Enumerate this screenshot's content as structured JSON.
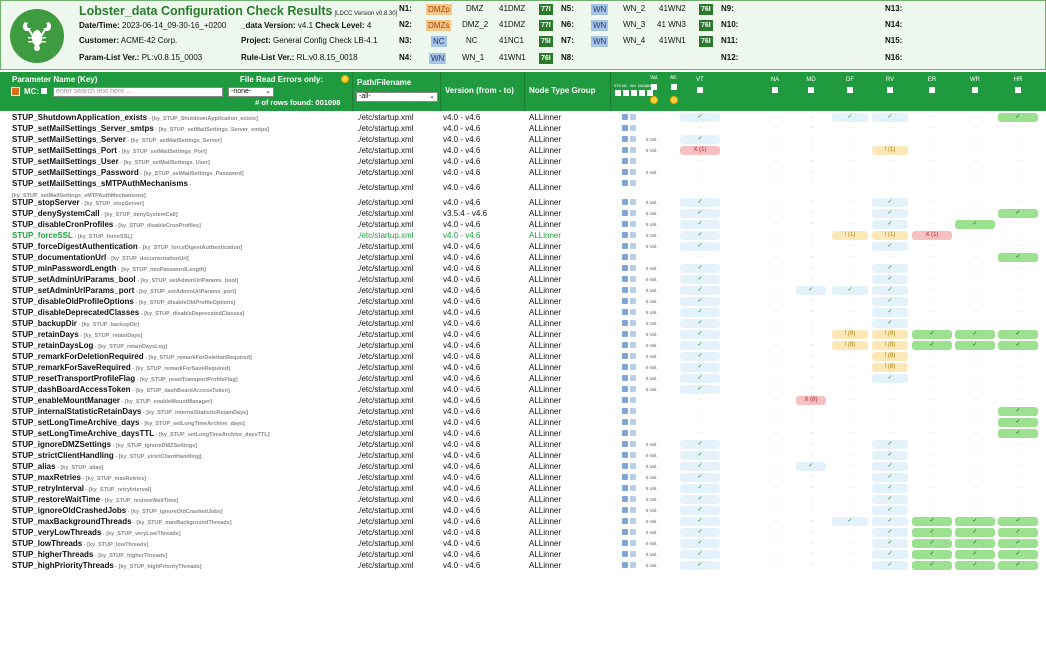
{
  "header": {
    "title": "Lobster_data Configuration Check Results",
    "version": "[LDCC Version v0.8.30]",
    "datetime_label": "Date/Time:",
    "datetime_value": "2023-06-14_09-30-16_+0200",
    "data_version_label": "_data Version:",
    "data_version_value": "v4.1",
    "check_level_label": "Check Level:",
    "check_level_value": "4",
    "customer_label": "Customer:",
    "customer_value": "ACME-42 Corp.",
    "project_label": "Project:",
    "project_value": "General Config Check LB-4.1",
    "param_list_label": "Param-List Ver.:",
    "param_list_value": "PL:v0.8.15_0003",
    "rule_list_label": "Rule-List Ver.:",
    "rule_list_value": "RL:v0.8.15_0018"
  },
  "nodes": {
    "n1": {
      "label": "N1:",
      "type": "DMZp",
      "name": "DMZ",
      "id": "41DMZ",
      "badge": "77I"
    },
    "n2": {
      "label": "N2:",
      "type": "DMZs",
      "name": "DMZ_2",
      "id": "41DMZ",
      "badge": "77I"
    },
    "n3": {
      "label": "N3:",
      "type": "NC",
      "name": "NC",
      "id": "41NC1",
      "badge": "75I"
    },
    "n4": {
      "label": "N4:",
      "type": "WN",
      "name": "WN_1",
      "id": "41WN1",
      "badge": "76I"
    },
    "n5": {
      "label": "N5:",
      "type": "WN",
      "name": "WN_2",
      "id": "41WN2",
      "badge": "76I"
    },
    "n6": {
      "label": "N6:",
      "type": "WN",
      "name": "WN_3",
      "id": "41 WN3",
      "badge": "76I"
    },
    "n7": {
      "label": "N7:",
      "type": "WN",
      "name": "WN_4",
      "id": "41WN1",
      "badge": "76I"
    },
    "n8": {
      "label": "N8:"
    },
    "n9": {
      "label": "N9:"
    },
    "n10": {
      "label": "N10:"
    },
    "n11": {
      "label": "N11:"
    },
    "n12": {
      "label": "N12:"
    },
    "n13": {
      "label": "N13:"
    },
    "n14": {
      "label": "N14:"
    },
    "n15": {
      "label": "N15:"
    },
    "n16": {
      "label": "N16:"
    }
  },
  "table_header": {
    "param_name": "Parameter Name (Key)",
    "file_read_errors": "File Read Errors only:",
    "mc_label": "MC:",
    "search_placeholder": "enter search text here ...",
    "none_option": "-none-",
    "rows_found": "# of rows found: 001098",
    "path_label": "Path/Filename",
    "path_option": "-all-",
    "version_label": "Version (from - to)",
    "node_group_label": "Node Type Group",
    "mini_labels": [
      "STD",
      "NC",
      "WN",
      "DMZp",
      "DMZs"
    ],
    "val_label": "Val.",
    "all_label": "All:",
    "type_cols": [
      "VT",
      "NA",
      "MD",
      "DF",
      "RV",
      "ER",
      "WR",
      "HR"
    ]
  },
  "rows": [
    {
      "name": "STUP_ShutdownApplication_exists",
      "key": "[ky_STUP_ShutdownApplication_exists]",
      "path": "./etc/startup.xml",
      "ver": "v4.0 - v4.6",
      "grp": "ALLinner",
      "val": "",
      "cells": {
        "VT": "✓",
        "DF": "✓",
        "RV": "✓",
        "HR": "✓g"
      }
    },
    {
      "name": "STUP_setMailSettings_Server_smtps",
      "key": "[ky_STUP_setMailSettings_Server_smtps]",
      "path": "./etc/startup.xml",
      "ver": "v4.0 - v4.6",
      "grp": "ALLinner",
      "val": "",
      "cells": {}
    },
    {
      "name": "STUP_setMailSettings_Server",
      "key": "[ky_STUP_setMailSettings_Server]",
      "path": "./etc/startup.xml",
      "ver": "v4.0 - v4.6",
      "grp": "ALLinner",
      "val": "5 Val.",
      "cells": {
        "VT": "✓"
      }
    },
    {
      "name": "STUP_setMailSettings_Port",
      "key": "[ky_STUP_setMailSettings_Port]",
      "path": "./etc/startup.xml",
      "ver": "v4.0 - v4.6",
      "grp": "ALLinner",
      "val": "5 Val.",
      "cells": {
        "VT": "X (1)e",
        "RV": "! (1)w"
      }
    },
    {
      "name": "STUP_setMailSettings_User",
      "key": "[ky_STUP_setMailSettings_User]",
      "path": "./etc/startup.xml",
      "ver": "v4.0 - v4.6",
      "grp": "ALLinner",
      "val": "",
      "cells": {}
    },
    {
      "name": "STUP_setMailSettings_Password",
      "key": "[ky_STUP_setMailSettings_Password]",
      "path": "./etc/startup.xml",
      "ver": "v4.0 - v4.6",
      "grp": "ALLinner",
      "val": "5 Val.",
      "cells": {}
    },
    {
      "name": "STUP_setMailSettings_sMTPAuthMechanisms",
      "key": "[ky_STUP_setMailSettings_sMTPAuthMechanisms]",
      "path": "./etc/startup.xml",
      "ver": "v4.0 - v4.6",
      "grp": "ALLinner",
      "val": "",
      "cells": {},
      "tall": true
    },
    {
      "name": "STUP_stopServer",
      "key": "[ky_STUP_stopServer]",
      "path": "./etc/startup.xml",
      "ver": "v4.0 - v4.6",
      "grp": "ALLinner",
      "val": "5 Val.",
      "cells": {
        "VT": "✓",
        "RV": "✓"
      }
    },
    {
      "name": "STUP_denySystemCall",
      "key": "[ky_STUP_denySystemCall]",
      "path": "./etc/startup.xml",
      "ver": "v3.5.4 - v4.6",
      "grp": "ALLinner",
      "val": "5 Val.",
      "cells": {
        "VT": "✓",
        "RV": "✓",
        "HR": "✓g"
      }
    },
    {
      "name": "STUP_disableCronProfiles",
      "key": "[ky_STUP_disableCronProfiles]",
      "path": "./etc/startup.xml",
      "ver": "v4.0 - v4.6",
      "grp": "ALLinner",
      "val": "5 Val.",
      "cells": {
        "VT": "✓",
        "RV": "✓",
        "WR": "✓g"
      }
    },
    {
      "name": "STUP_forceSSL",
      "key": "[ky_STUP_forceSSL]",
      "path": "./etc/startup.xml",
      "ver": "v4.0 - v4.6",
      "grp": "ALLinner",
      "val": "5 Val.",
      "cells": {
        "VT": "✓",
        "DF": "! (1)w",
        "RV": "! (1)w",
        "ER": "X (1)e"
      },
      "hi": true
    },
    {
      "name": "STUP_forceDigestAuthentication",
      "key": "[ky_STUP_forceDigestAuthentication]",
      "path": "./etc/startup.xml",
      "ver": "v4.0 - v4.6",
      "grp": "ALLinner",
      "val": "5 Val.",
      "cells": {
        "VT": "✓",
        "RV": "✓"
      }
    },
    {
      "name": "STUP_documentationUrl",
      "key": "[ky_STUP_documentationUrl]",
      "path": "./etc/startup.xml",
      "ver": "v4.0 - v4.6",
      "grp": "ALLinner",
      "val": "",
      "cells": {
        "HR": "✓g"
      }
    },
    {
      "name": "STUP_minPasswordLength",
      "key": "[ky_STUP_minPasswordLength]",
      "path": "./etc/startup.xml",
      "ver": "v4.0 - v4.6",
      "grp": "ALLinner",
      "val": "5 Val.",
      "cells": {
        "VT": "✓",
        "RV": "✓"
      }
    },
    {
      "name": "STUP_setAdminUrlParams_bool",
      "key": "[ky_STUP_setAdminUrlParams_bool]",
      "path": "./etc/startup.xml",
      "ver": "v4.0 - v4.6",
      "grp": "ALLinner",
      "val": "5 Val.",
      "cells": {
        "VT": "✓",
        "RV": "✓"
      }
    },
    {
      "name": "STUP_setAdminUrlParams_port",
      "key": "[ky_STUP_setAdminUrlParams_port]",
      "path": "./etc/startup.xml",
      "ver": "v4.0 - v4.6",
      "grp": "ALLinner",
      "val": "5 Val.",
      "cells": {
        "VT": "✓",
        "MD": "✓",
        "DF": "✓",
        "RV": "✓"
      }
    },
    {
      "name": "STUP_disableOldProfileOptions",
      "key": "[ky_STUP_disableOldProfileOptions]",
      "path": "./etc/startup.xml",
      "ver": "v4.0 - v4.6",
      "grp": "ALLinner",
      "val": "5 Val.",
      "cells": {
        "VT": "✓",
        "RV": "✓"
      }
    },
    {
      "name": "STUP_disableDeprecatedClasses",
      "key": "[ky_STUP_disableDeprecatedClasses]",
      "path": "./etc/startup.xml",
      "ver": "v4.0 - v4.6",
      "grp": "ALLinner",
      "val": "5 Val.",
      "cells": {
        "VT": "✓",
        "RV": "✓"
      }
    },
    {
      "name": "STUP_backupDir",
      "key": "[ky_STUP_backupDir]",
      "path": "./etc/startup.xml",
      "ver": "v4.0 - v4.6",
      "grp": "ALLinner",
      "val": "5 Val.",
      "cells": {
        "VT": "✓",
        "RV": "✓"
      }
    },
    {
      "name": "STUP_retainDays",
      "key": "[ky_STUP_retainDays]",
      "path": "./etc/startup.xml",
      "ver": "v4.0 - v4.6",
      "grp": "ALLinner",
      "val": "5 Val.",
      "cells": {
        "VT": "✓",
        "DF": "! (8)w",
        "RV": "! (8)w",
        "ER": "✓g",
        "WR": "✓g",
        "HR": "✓g"
      }
    },
    {
      "name": "STUP_retainDaysLog",
      "key": "[ky_STUP_retainDaysLog]",
      "path": "./etc/startup.xml",
      "ver": "v4.0 - v4.6",
      "grp": "ALLinner",
      "val": "5 Val.",
      "cells": {
        "VT": "✓",
        "DF": "! (8)w",
        "RV": "! (8)w",
        "ER": "✓g",
        "WR": "✓g",
        "HR": "✓g"
      }
    },
    {
      "name": "STUP_remarkForDeletionRequired",
      "key": "[ky_STUP_remarkForDeletionRequired]",
      "path": "./etc/startup.xml",
      "ver": "v4.0 - v4.6",
      "grp": "ALLinner",
      "val": "5 Val.",
      "cells": {
        "VT": "✓",
        "RV": "! (8)w"
      }
    },
    {
      "name": "STUP_remarkForSaveRequired",
      "key": "[ky_STUP_remarkForSaveRequired]",
      "path": "./etc/startup.xml",
      "ver": "v4.0 - v4.6",
      "grp": "ALLinner",
      "val": "5 Val.",
      "cells": {
        "VT": "✓",
        "RV": "! (8)w"
      }
    },
    {
      "name": "STUP_resetTransportProfileFlag",
      "key": "[ky_STUP_resetTransportProfileFlag]",
      "path": "./etc/startup.xml",
      "ver": "v4.0 - v4.6",
      "grp": "ALLinner",
      "val": "5 Val.",
      "cells": {
        "VT": "✓",
        "RV": "✓"
      }
    },
    {
      "name": "STUP_dashBoardAccessToken",
      "key": "[ky_STUP_dashBoardAccessToken]",
      "path": "./etc/startup.xml",
      "ver": "v4.0 - v4.6",
      "grp": "ALLinner",
      "val": "5 Val.",
      "cells": {
        "VT": "✓"
      }
    },
    {
      "name": "STUP_enableMountManager",
      "key": "[ky_STUP_enableMountManager]",
      "path": "./etc/startup.xml",
      "ver": "v4.0 - v4.6",
      "grp": "ALLinner",
      "val": "",
      "cells": {
        "MD": "X (8)e"
      }
    },
    {
      "name": "STUP_internalStatisticRetainDays",
      "key": "[ky_STUP_internalStatisticRetainDays]",
      "path": "./etc/startup.xml",
      "ver": "v4.0 - v4.6",
      "grp": "ALLinner",
      "val": "",
      "cells": {
        "HR": "✓g"
      }
    },
    {
      "name": "STUP_setLongTimeArchive_days",
      "key": "[ky_STUP_setLongTimeArchive_days]",
      "path": "./etc/startup.xml",
      "ver": "v4.0 - v4.6",
      "grp": "ALLinner",
      "val": "",
      "cells": {
        "HR": "✓g"
      }
    },
    {
      "name": "STUP_setLongTimeArchive_daysTTL",
      "key": "[ky_STUP_setLongTimeArchive_daysTTL]",
      "path": "./etc/startup.xml",
      "ver": "v4.0 - v4.6",
      "grp": "ALLinner",
      "val": "",
      "cells": {
        "HR": "✓g"
      }
    },
    {
      "name": "STUP_ignoreDMZSettings",
      "key": "[ky_STUP_ignoreDMZSettings]",
      "path": "./etc/startup.xml",
      "ver": "v4.0 - v4.6",
      "grp": "ALLinner",
      "val": "5 Val.",
      "cells": {
        "VT": "✓",
        "RV": "✓"
      }
    },
    {
      "name": "STUP_strictClientHandling",
      "key": "[ky_STUP_strictClientHandling]",
      "path": "./etc/startup.xml",
      "ver": "v4.0 - v4.6",
      "grp": "ALLinner",
      "val": "5 Val.",
      "cells": {
        "VT": "✓",
        "RV": "✓"
      }
    },
    {
      "name": "STUP_alias",
      "key": "[ky_STUP_alias]",
      "path": "./etc/startup.xml",
      "ver": "v4.0 - v4.6",
      "grp": "ALLinner",
      "val": "5 Val.",
      "cells": {
        "VT": "✓",
        "MD": "✓",
        "RV": "✓"
      }
    },
    {
      "name": "STUP_maxRetries",
      "key": "[ky_STUP_maxRetries]",
      "path": "./etc/startup.xml",
      "ver": "v4.0 - v4.6",
      "grp": "ALLinner",
      "val": "5 Val.",
      "cells": {
        "VT": "✓",
        "RV": "✓"
      }
    },
    {
      "name": "STUP_retryInterval",
      "key": "[ky_STUP_retryInterval]",
      "path": "./etc/startup.xml",
      "ver": "v4.0 - v4.6",
      "grp": "ALLinner",
      "val": "5 Val.",
      "cells": {
        "VT": "✓",
        "RV": "✓"
      }
    },
    {
      "name": "STUP_restoreWaitTime",
      "key": "[ky_STUP_restoreWaitTime]",
      "path": "./etc/startup.xml",
      "ver": "v4.0 - v4.6",
      "grp": "ALLinner",
      "val": "5 Val.",
      "cells": {
        "VT": "✓",
        "RV": "✓"
      }
    },
    {
      "name": "STUP_ignoreOldCrashedJobs",
      "key": "[ky_STUP_ignoreOldCrashedJobs]",
      "path": "./etc/startup.xml",
      "ver": "v4.0 - v4.6",
      "grp": "ALLinner",
      "val": "5 Val.",
      "cells": {
        "VT": "✓",
        "RV": "✓"
      }
    },
    {
      "name": "STUP_maxBackgroundThreads",
      "key": "[ky_STUP_maxBackgroundThreads]",
      "path": "./etc/startup.xml",
      "ver": "v4.0 - v4.6",
      "grp": "ALLinner",
      "val": "5 Val.",
      "cells": {
        "VT": "✓",
        "DF": "✓",
        "RV": "✓",
        "ER": "✓g",
        "WR": "✓g",
        "HR": "✓g"
      }
    },
    {
      "name": "STUP_veryLowThreads",
      "key": "[ky_STUP_veryLowThreads]",
      "path": "./etc/startup.xml",
      "ver": "v4.0 - v4.6",
      "grp": "ALLinner",
      "val": "5 Val.",
      "cells": {
        "VT": "✓",
        "RV": "✓",
        "ER": "✓g",
        "WR": "✓g",
        "HR": "✓g"
      }
    },
    {
      "name": "STUP_lowThreads",
      "key": "[ky_STUP_lowThreads]",
      "path": "./etc/startup.xml",
      "ver": "v4.0 - v4.6",
      "grp": "ALLinner",
      "val": "5 Val.",
      "cells": {
        "VT": "✓",
        "RV": "✓",
        "ER": "✓g",
        "WR": "✓g",
        "HR": "✓g"
      }
    },
    {
      "name": "STUP_higherThreads",
      "key": "[ky_STUP_higherThreads]",
      "path": "./etc/startup.xml",
      "ver": "v4.0 - v4.6",
      "grp": "ALLinner",
      "val": "5 Val.",
      "cells": {
        "VT": "✓",
        "RV": "✓",
        "ER": "✓g",
        "WR": "✓g",
        "HR": "✓g"
      }
    },
    {
      "name": "STUP_highPriorityThreads",
      "key": "[ky_STUP_highPriorityThreads]",
      "path": "./etc/startup.xml",
      "ver": "v4.0 - v4.6",
      "grp": "ALLinner",
      "val": "5 Val.",
      "cells": {
        "VT": "✓",
        "RV": "✓",
        "ER": "✓g",
        "WR": "✓g",
        "HR": "✓g"
      }
    }
  ]
}
